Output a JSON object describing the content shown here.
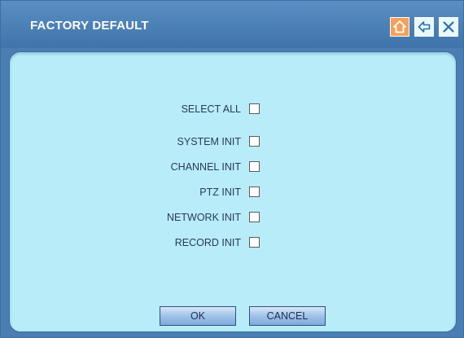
{
  "window": {
    "title": "FACTORY DEFAULT",
    "buttons": [
      {
        "icon": "home-icon"
      },
      {
        "icon": "back-arrow-icon"
      },
      {
        "icon": "close-icon"
      }
    ]
  },
  "options": [
    {
      "label": "SELECT ALL",
      "checked": false
    },
    {
      "label": "SYSTEM INIT",
      "checked": false
    },
    {
      "label": "CHANNEL INIT",
      "checked": false
    },
    {
      "label": "PTZ INIT",
      "checked": false
    },
    {
      "label": "NETWORK INIT",
      "checked": false
    },
    {
      "label": "RECORD INIT",
      "checked": false
    }
  ],
  "actions": {
    "ok_label": "OK",
    "cancel_label": "CANCEL"
  },
  "colors": {
    "titlebar": "#4a7fb4",
    "panel": "#b7ecf8",
    "home_button": "#f5a05a",
    "text": "#2a3a5a"
  }
}
